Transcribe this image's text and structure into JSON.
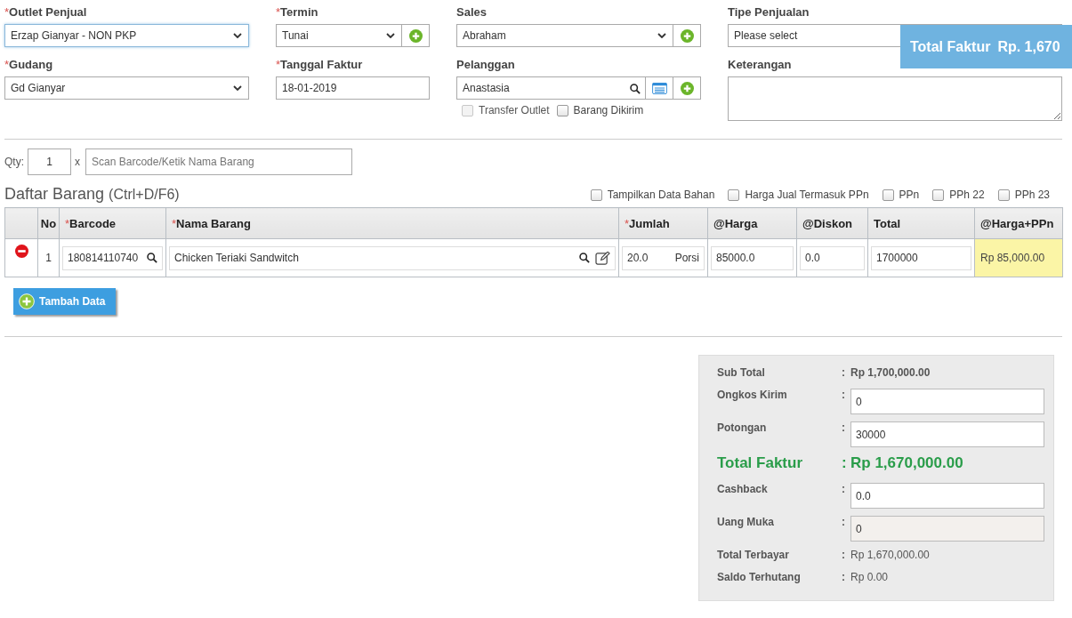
{
  "form": {
    "outlet": {
      "label": "Outlet Penjual",
      "required_mark": "*",
      "value": "Erzap Gianyar - NON PKP"
    },
    "termin": {
      "label": "Termin",
      "required_mark": "*",
      "value": "Tunai"
    },
    "sales": {
      "label": "Sales",
      "value": "Abraham"
    },
    "tipe": {
      "label": "Tipe Penjualan",
      "placeholder": "Please select"
    },
    "gudang": {
      "label": "Gudang",
      "required_mark": "*",
      "value": "Gd Gianyar"
    },
    "tanggal": {
      "label": "Tanggal Faktur",
      "required_mark": "*",
      "value": "18-01-2019"
    },
    "pelanggan": {
      "label": "Pelanggan",
      "value": "Anastasia"
    },
    "pelanggan_options": [
      {
        "label": "Transfer Outlet",
        "checked": false,
        "disabled": true
      },
      {
        "label": "Barang Dikirim",
        "checked": false,
        "disabled": false
      }
    ],
    "keterangan": {
      "label": "Keterangan"
    }
  },
  "banner": {
    "label": "Total Faktur",
    "value": "Rp. 1,670"
  },
  "scan": {
    "qty_label": "Qty:",
    "qty": "1",
    "times": "x",
    "placeholder": "Scan Barcode/Ketik Nama Barang"
  },
  "list_title": "Daftar Barang",
  "list_shortcut": "(Ctrl+D/F6)",
  "options": [
    {
      "label": "Tampilkan Data Bahan",
      "checked": false
    },
    {
      "label": "Harga Jual Termasuk PPn",
      "checked": false
    },
    {
      "label": "PPn",
      "checked": false
    },
    {
      "label": "PPh 22",
      "checked": false
    },
    {
      "label": "PPh 23",
      "checked": false
    }
  ],
  "table": {
    "columns": [
      {
        "label": "No"
      },
      {
        "label": "Barcode",
        "required_mark": "*"
      },
      {
        "label": "Nama Barang",
        "required_mark": "*"
      },
      {
        "label": "Jumlah",
        "required_mark": "*"
      },
      {
        "label": "@Harga"
      },
      {
        "label": "@Diskon"
      },
      {
        "label": "Total"
      },
      {
        "label": "@Harga+PPn"
      }
    ],
    "rows": [
      {
        "no": "1",
        "barcode": "180814110740",
        "nama": "Chicken Teriaki Sandwitch",
        "jumlah": "20.0",
        "unit": "Porsi",
        "harga": "85000.0",
        "diskon": "0.0",
        "total": "1700000",
        "harga_ppn": "Rp 85,000.00"
      }
    ]
  },
  "add_button": "Tambah Data",
  "summary": [
    {
      "kind": "text",
      "label": "Sub Total",
      "colon": ":",
      "value": "Rp 1,700,000.00"
    },
    {
      "kind": "input",
      "label": "Ongkos Kirim",
      "colon": ":",
      "value": "0"
    },
    {
      "kind": "input",
      "label": "Potongan",
      "colon": ":",
      "value": "30000"
    },
    {
      "kind": "total",
      "label": "Total Faktur",
      "colon": ":",
      "value": "Rp 1,670,000.00"
    },
    {
      "kind": "input",
      "label": "Cashback",
      "colon": ":",
      "value": "0.0"
    },
    {
      "kind": "readonly",
      "label": "Uang Muka",
      "colon": ":",
      "value": "0"
    },
    {
      "kind": "text",
      "label": "Total Terbayar",
      "colon": ":",
      "value": "Rp 1,670,000.00"
    },
    {
      "kind": "text",
      "label": "Saldo Terhutang",
      "colon": ":",
      "value": "Rp 0.00"
    }
  ]
}
